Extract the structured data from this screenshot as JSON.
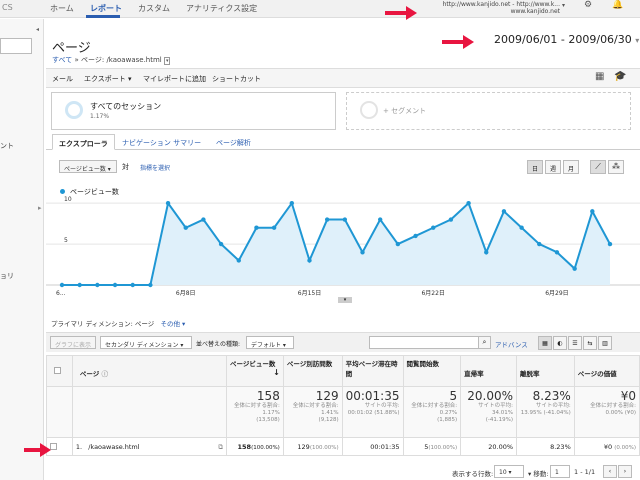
{
  "topnav": {
    "left_cut": "CS",
    "tabs": [
      "ホーム",
      "レポート",
      "カスタム",
      "アナリティクス設定"
    ],
    "account_line1": "http://www.kanjido.net - http://www.k...",
    "account_line2": "www.kanjido.net"
  },
  "sidebar": {
    "item1": "ント",
    "item2": "ョリ"
  },
  "header": {
    "title": "ページ",
    "crumb_all": "すべて",
    "crumb_sep": "»",
    "crumb_page": "ページ: /kaoawase.html",
    "date_range": "2009/06/01 - 2009/06/30"
  },
  "toolbar": {
    "mail": "メール",
    "export": "エクスポート ▾",
    "add_report": "マイレポートに追加",
    "shortcut": "ショートカット"
  },
  "segments": {
    "all_sessions": "すべてのセッション",
    "all_sessions_pct": "1.17%",
    "add_segment": "+ セグメント"
  },
  "tabs": [
    "エクスプローラ",
    "ナビゲーション サマリー",
    "ページ解析"
  ],
  "chart_controls": {
    "metric": "ページビュー数",
    "vs": "対",
    "select_metric": "指標を選択",
    "day": "日",
    "week": "週",
    "month": "月"
  },
  "chart_data": {
    "type": "area",
    "series": [
      {
        "name": "ページビュー数",
        "values": [
          0,
          0,
          0,
          0,
          0,
          0,
          10,
          7,
          8,
          5,
          3,
          7,
          7,
          10,
          3,
          8,
          8,
          4,
          8,
          5,
          6,
          7,
          8,
          10,
          4,
          9,
          7,
          5,
          4,
          2,
          9,
          5
        ]
      }
    ],
    "x_start_label": "6...",
    "x_tick_labels": [
      "6月8日",
      "6月15日",
      "6月22日",
      "6月29日"
    ],
    "x_tick_index": [
      7,
      14,
      21,
      28
    ],
    "y_ticks": [
      5,
      10
    ],
    "ylim": [
      0,
      11
    ],
    "color": "#1f97d4"
  },
  "primary_dim": {
    "label": "プライマリ ディメンション:",
    "value": "ページ",
    "other": "その他 ▾"
  },
  "filter_bar": {
    "graph_by": "グラフに表示",
    "secondary": "セカンダリ ディメンション ▾",
    "sort_label": "並べ替えの種類:",
    "sort_value": "デフォルト ▾",
    "advanced": "アドバンス"
  },
  "table": {
    "headers": [
      "ページ",
      "ページビュー数",
      "ページ別訪問数",
      "平均ページ滞在時間",
      "閲覧開始数",
      "直帰率",
      "離脱率",
      "ページの価値"
    ],
    "totals": {
      "values": [
        "158",
        "129",
        "00:01:35",
        "5",
        "20.00%",
        "8.23%",
        "¥0"
      ],
      "sub1": [
        "全体に対する割合: 1.17%",
        "全体に対する割合: 1.41%",
        "サイトの平均:",
        "全体に対する割合: 0.27%",
        "サイトの平均:",
        "サイトの平均:",
        "全体に対する割合:"
      ],
      "sub2": [
        "(13,508)",
        "(9,128)",
        "00:01:02 (51.88%)",
        "(1,885)",
        "34.01% (-41.19%)",
        "13.95% (-41.04%)",
        "0.00% (¥0)"
      ]
    },
    "rows": [
      {
        "num": "1.",
        "page": "/kaoawase.html",
        "pv": "158",
        "pv_pct": "(100.00%)",
        "visits": "129",
        "visits_pct": "(100.00%)",
        "time": "00:01:35",
        "entrances": "5",
        "entr_pct": "(100.00%)",
        "bounce": "20.00%",
        "exit": "8.23%",
        "value": "¥0",
        "value_pct": "(0.00%)"
      }
    ]
  },
  "footer": {
    "rows_label": "表示する行数:",
    "rows_value": "10",
    "goto_label": "移動:",
    "goto_value": "1",
    "range": "1 - 1/1"
  },
  "colors": {
    "accent": "#2a5db0",
    "arrow": "#e81540",
    "series": "#1f97d4"
  }
}
